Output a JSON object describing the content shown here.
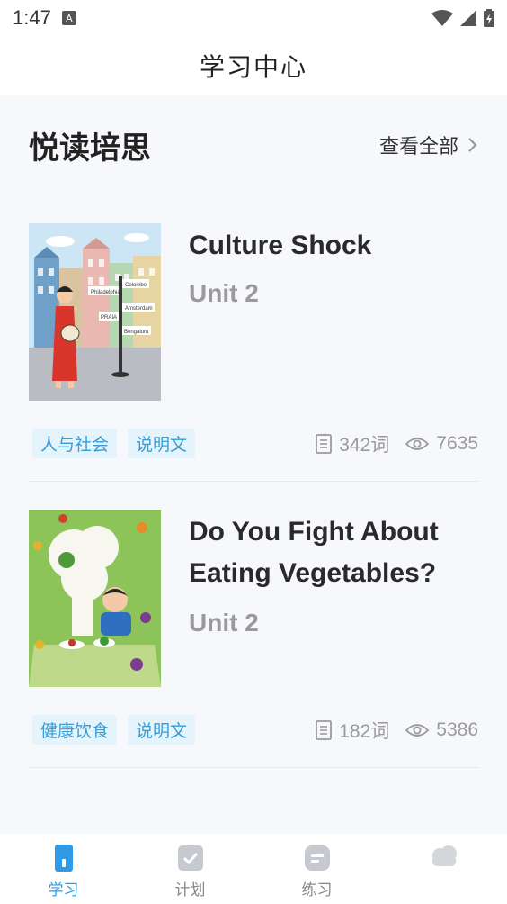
{
  "status_bar": {
    "time": "1:47",
    "notification_badge": "A"
  },
  "header": {
    "title": "学习中心"
  },
  "section": {
    "title": "悦读培思",
    "view_all": "查看全部"
  },
  "books": [
    {
      "title": "Culture Shock",
      "unit": "Unit 2",
      "tags": [
        "人与社会",
        "说明文"
      ],
      "words": "342词",
      "views": "7635",
      "cover_signs": [
        "Philadelphia",
        "Colombo",
        "Amsterdam",
        "PRAIA",
        "Bengaluru"
      ]
    },
    {
      "title": "Do You Fight About Eating Vegetables?",
      "unit": "Unit 2",
      "tags": [
        "健康饮食",
        "说明文"
      ],
      "words": "182词",
      "views": "5386"
    }
  ],
  "tabbar": {
    "items": [
      {
        "label": "学习",
        "icon": "study-icon",
        "active": true
      },
      {
        "label": "计划",
        "icon": "plan-icon",
        "active": false
      },
      {
        "label": "练习",
        "icon": "practice-icon",
        "active": false
      },
      {
        "label": "",
        "icon": "profile-icon",
        "active": false
      }
    ]
  },
  "colors": {
    "accent": "#2f9be6",
    "tag_bg": "#e5f3fb",
    "tag_text": "#3a9cd5"
  }
}
